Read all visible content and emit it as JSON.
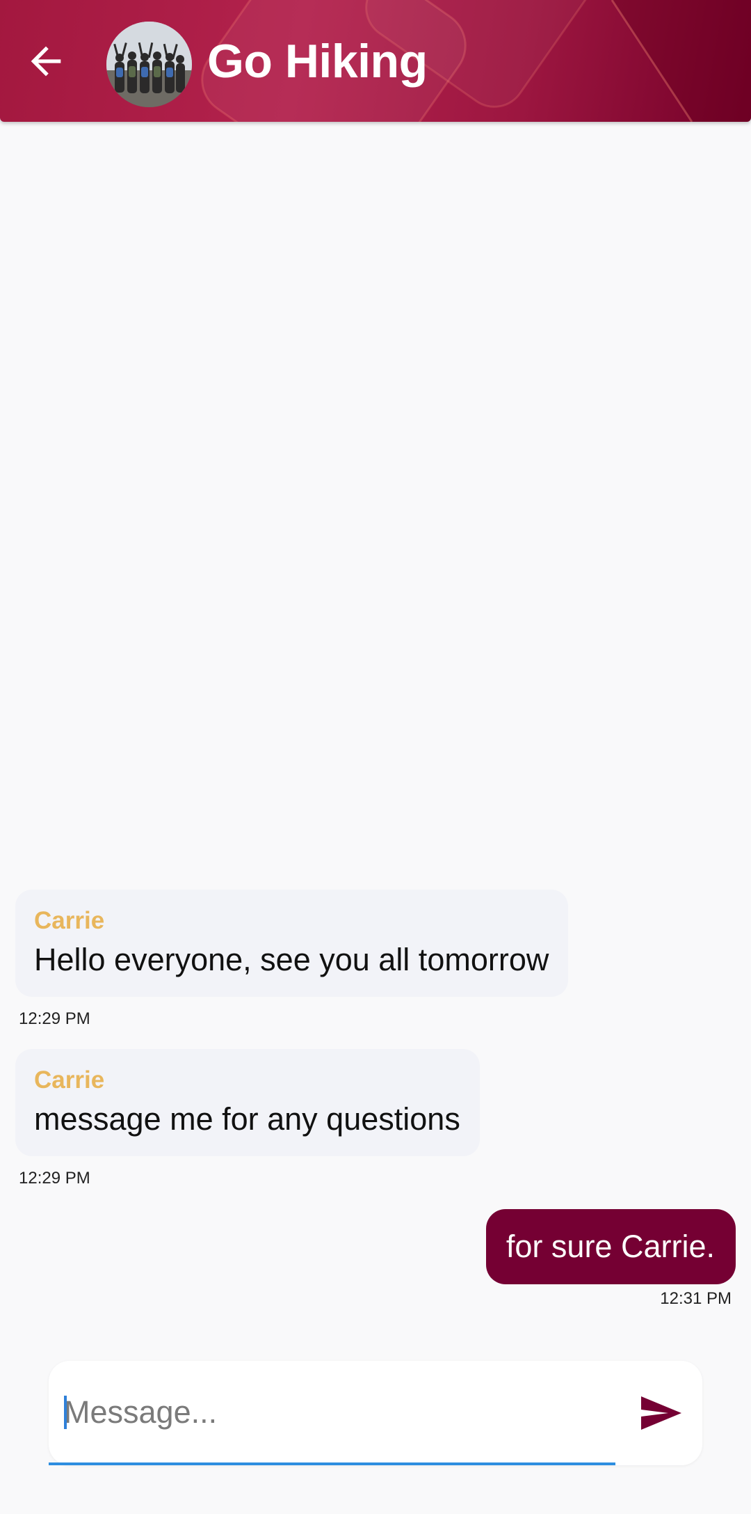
{
  "header": {
    "title": "Go Hiking",
    "back_icon": "arrow-left-icon",
    "avatar_icon": "group-photo-avatar",
    "gradient": [
      "#a3183f",
      "#b3224d",
      "#740028"
    ]
  },
  "messages": [
    {
      "sender": "Carrie",
      "text": "Hello everyone, see you all tomorrow",
      "time": "12:29 PM",
      "direction": "incoming"
    },
    {
      "sender": "Carrie",
      "text": "message me for any questions",
      "time": "12:29 PM",
      "direction": "incoming"
    },
    {
      "text": "for sure Carrie.",
      "time": "12:31 PM",
      "direction": "outgoing"
    }
  ],
  "composer": {
    "placeholder": "Message...",
    "value": "",
    "send_icon": "send-icon"
  },
  "colors": {
    "sender_name": "#e8b65c",
    "outgoing_bubble": "#750033",
    "incoming_bubble": "#f2f3f8",
    "input_underline": "#2e8ee0"
  }
}
